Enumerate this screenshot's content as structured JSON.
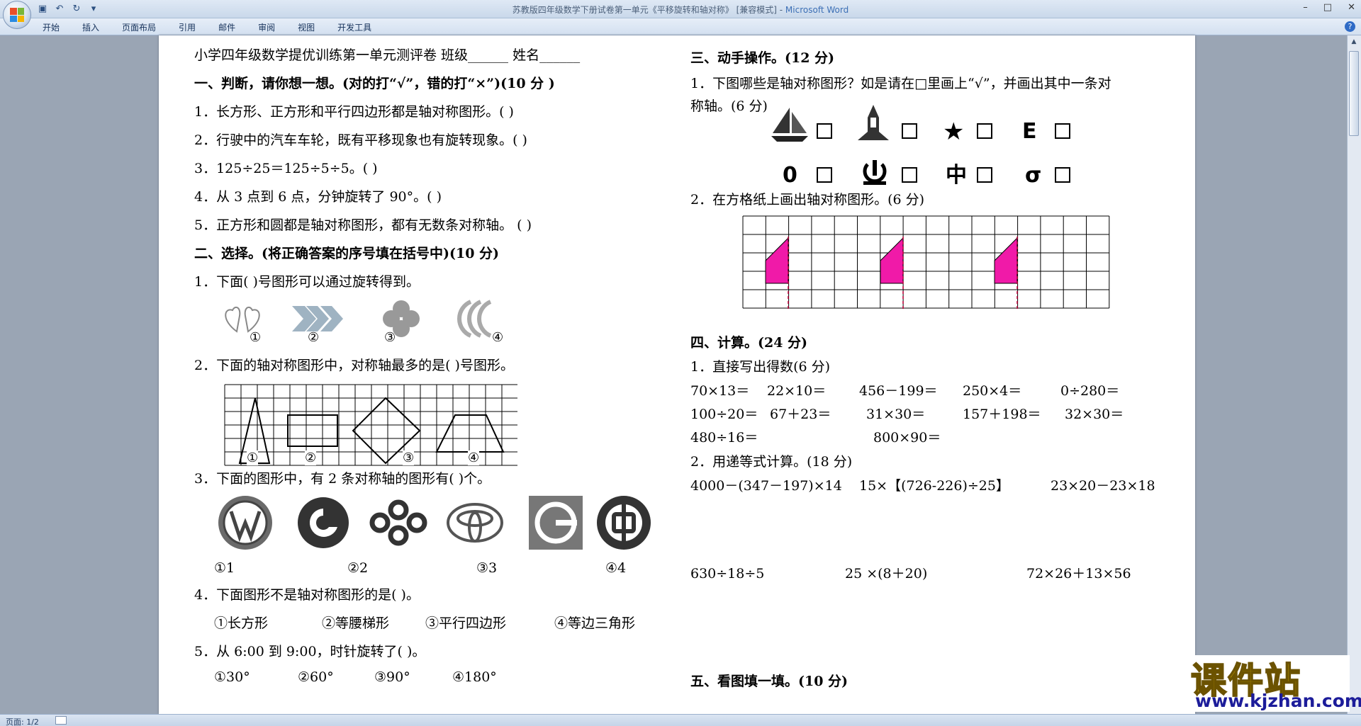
{
  "window": {
    "title": "苏教版四年级数学下册试卷第一单元《平移旋转和轴对称》 [兼容模式] - Microsoft Word",
    "title_main": "苏教版四年级数学下册试卷第一单元《平移旋转和轴对称》 [兼容模式] - ",
    "title_brand": "Microsoft Word"
  },
  "ribbon": {
    "tabs": [
      "开始",
      "插入",
      "页面布局",
      "引用",
      "邮件",
      "审阅",
      "视图",
      "开发工具"
    ]
  },
  "status": {
    "page": "页面: 1/2"
  },
  "watermark": {
    "name": "课件站",
    "url": "www.kjzhan.com"
  },
  "doc": {
    "heading": "小学四年级数学提优训练第一单元测评卷 班级______ 姓名______",
    "s1": {
      "title": "一、判断，请你想一想。(对的打“√”，错的打“×”)(10 分 )",
      "items": [
        "1．长方形、正方形和平行四边形都是轴对称图形。(      )",
        "2．行驶中的汽车车轮，既有平移现象也有旋转现象。(      )",
        "3．125÷25＝125÷5÷5。(      )",
        "4．从 3 点到 6 点，分钟旋转了 90°。(      )",
        "5．正方形和圆都是轴对称图形，都有无数条对称轴。 (      )"
      ]
    },
    "s2": {
      "title": "二、选择。(将正确答案的序号填在括号中)(10 分)",
      "q1": "1．下面(      )号图形可以通过旋转得到。",
      "q1_labels": [
        "①",
        "②",
        "③",
        "④"
      ],
      "q2": "2．下面的轴对称图形中，对称轴最多的是(      )号图形。",
      "q2_labels": [
        "①",
        "②",
        "③",
        "④"
      ],
      "q3": "3．下面的图形中，有 2 条对称轴的图形有(      )个。",
      "q3_options": [
        "①1",
        "②2",
        "③3",
        "④4"
      ],
      "q4": "4．下面图形不是轴对称图形的是(      )。",
      "q4_options": [
        "①长方形",
        "②等腰梯形",
        "③平行四边形",
        "④等边三角形"
      ],
      "q5": "5．从 6:00 到 9:00，时针旋转了(      )。",
      "q5_options": [
        "①30°",
        "②60°",
        "③90°",
        "④180°"
      ]
    },
    "s3": {
      "title": "三、动手操作。(12 分)",
      "q1_line1": "1．下图哪些是轴对称图形？如是请在□里画上“√”，并画出其中一条对",
      "q1_line2": "称轴。(6 分)",
      "row1_glyphs": [
        "★",
        "E"
      ],
      "row2_glyphs": [
        "0",
        "中",
        "σ"
      ],
      "q2": "2．在方格纸上画出轴对称图形。(6 分)"
    },
    "s4": {
      "title": "四、计算。(24 分)",
      "q1": "1．直接写出得数(6 分)",
      "row1": [
        "70×13＝",
        "22×10＝",
        "456－199＝",
        "250×4＝",
        "0÷280＝"
      ],
      "row2": [
        "100÷20＝",
        "67＋23＝",
        "31×30＝",
        "157＋198＝",
        "32×30＝"
      ],
      "row3": [
        "480÷16＝",
        "800×90＝"
      ],
      "q2": "2．用递等式计算。(18 分)",
      "row4": [
        "4000－(347－197)×14",
        "15×【(726-226)÷25】",
        "23×20－23×18"
      ],
      "row5": [
        "630÷18÷5",
        "25 ×(8＋20)",
        "72×26＋13×56"
      ]
    },
    "s5": {
      "title": "五、看图填一填。(10 分)"
    }
  }
}
